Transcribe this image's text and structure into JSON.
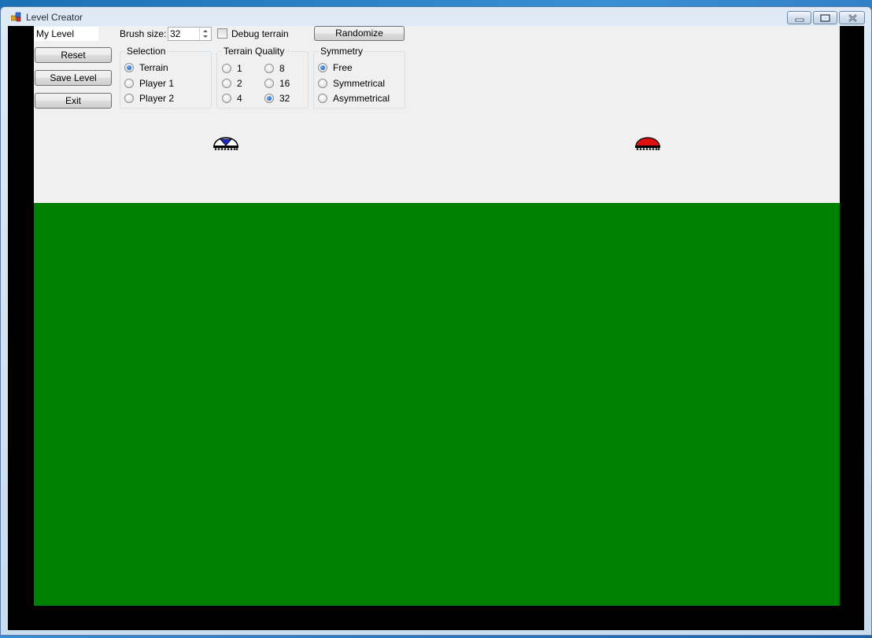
{
  "window": {
    "title": "Level Creator"
  },
  "toolbar": {
    "level_name_value": "My Level",
    "brush_size_label": "Brush size:",
    "brush_size_value": "32",
    "debug_terrain_label": "Debug terrain",
    "debug_terrain_checked": false,
    "randomize_label": "Randomize",
    "reset_label": "Reset",
    "save_label": "Save Level",
    "exit_label": "Exit"
  },
  "selection": {
    "title": "Selection",
    "options": [
      "Terrain",
      "Player 1",
      "Player 2"
    ],
    "selected": "Terrain"
  },
  "terrain_quality": {
    "title": "Terrain Quality",
    "options": [
      "1",
      "2",
      "4",
      "8",
      "16",
      "32"
    ],
    "selected": "32"
  },
  "symmetry": {
    "title": "Symmetry",
    "options": [
      "Free",
      "Symmetrical",
      "Asymmetrical"
    ],
    "selected": "Free"
  },
  "colors": {
    "sky": "#f0f0f0",
    "ground": "#008000",
    "border": "#000000",
    "player1": "#1e28c8",
    "player2": "#e01010"
  },
  "icons": {
    "player1_tank": "tank-icon",
    "player2_tank": "tank-icon"
  }
}
